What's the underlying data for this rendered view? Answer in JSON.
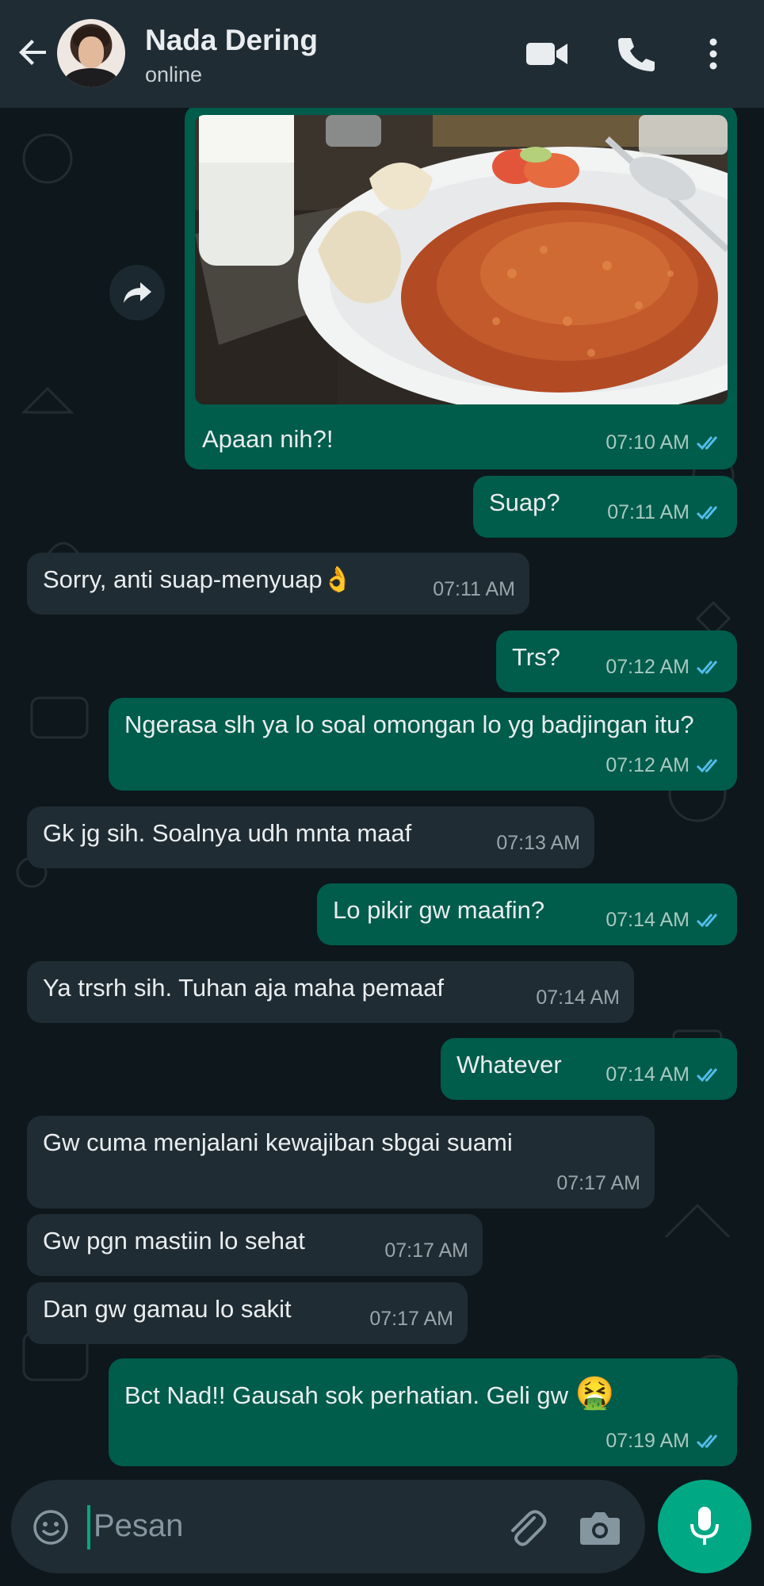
{
  "header": {
    "contact_name": "Nada Dering",
    "status": "online"
  },
  "messages": [
    {
      "id": "m1",
      "dir": "out",
      "text": "Apaan nih?!",
      "time": "07:10 AM",
      "read": true,
      "has_image": true
    },
    {
      "id": "m2",
      "dir": "out",
      "text": "Suap?",
      "time": "07:11 AM",
      "read": true
    },
    {
      "id": "m3",
      "dir": "in",
      "text": "Sorry, anti suap-menyuap",
      "emoji": "👌",
      "time": "07:11 AM"
    },
    {
      "id": "m4",
      "dir": "out",
      "text": "Trs?",
      "time": "07:12 AM",
      "read": true
    },
    {
      "id": "m5",
      "dir": "out",
      "text": "Ngerasa slh ya lo soal omongan lo yg badjingan itu?",
      "time": "07:12 AM",
      "read": true
    },
    {
      "id": "m6",
      "dir": "in",
      "text": "Gk jg sih. Soalnya udh mnta maaf",
      "time": "07:13 AM"
    },
    {
      "id": "m7",
      "dir": "out",
      "text": "Lo pikir gw maafin?",
      "time": "07:14 AM",
      "read": true
    },
    {
      "id": "m8",
      "dir": "in",
      "text": "Ya trsrh sih. Tuhan aja maha pemaaf",
      "time": "07:14 AM"
    },
    {
      "id": "m9",
      "dir": "out",
      "text": "Whatever",
      "time": "07:14 AM",
      "read": true
    },
    {
      "id": "m10",
      "dir": "in",
      "text": "Gw cuma menjalani kewajiban sbgai suami",
      "time": "07:17 AM"
    },
    {
      "id": "m11",
      "dir": "in",
      "text": "Gw pgn mastiin lo sehat",
      "time": "07:17 AM"
    },
    {
      "id": "m12",
      "dir": "in",
      "text": "Dan gw gamau lo sakit",
      "time": "07:17 AM"
    },
    {
      "id": "m13",
      "dir": "out",
      "text": "Bct Nad!! Gausah sok perhatian. Geli gw",
      "emoji": "🤮",
      "time": "07:19 AM",
      "read": true
    }
  ],
  "composer": {
    "placeholder": "Pesan"
  },
  "colors": {
    "header_bg": "#1f2c33",
    "chat_bg": "#0d171c",
    "outgoing_bubble": "#005c4b",
    "incoming_bubble": "#1f2c33",
    "accent": "#00a884",
    "read_ticks": "#53bdeb"
  },
  "icons": {
    "header": [
      "back-arrow-icon",
      "video-call-icon",
      "phone-icon",
      "more-vert-icon"
    ],
    "composer": [
      "emoji-icon",
      "attach-clip-icon",
      "camera-icon",
      "mic-icon"
    ],
    "message": [
      "forward-icon",
      "double-check-icon"
    ]
  }
}
